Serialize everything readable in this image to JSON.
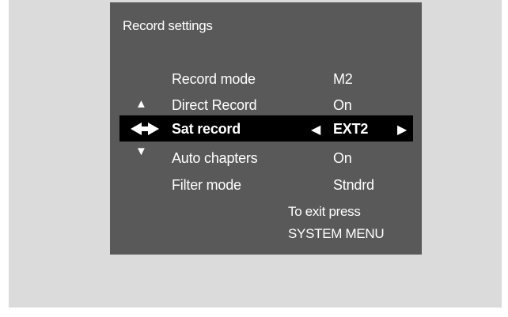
{
  "osd": {
    "title": "Record settings",
    "items": [
      {
        "label": "Record mode",
        "value": "M2"
      },
      {
        "label": "Direct Record",
        "value": "On"
      },
      {
        "label": "Sat record",
        "value": "EXT2"
      },
      {
        "label": "Auto chapters",
        "value": "On"
      },
      {
        "label": "Filter mode",
        "value": "Stndrd"
      }
    ],
    "nav": {
      "up": "▲",
      "down": "▼",
      "left": "◀",
      "right": "▶"
    },
    "footer": {
      "line1": "To exit press",
      "line2": "SYSTEM MENU"
    }
  },
  "colors": {
    "frame": "#dbdbdb",
    "osd_bg": "#595959",
    "highlight": "#000000",
    "text": "#ffffff"
  }
}
